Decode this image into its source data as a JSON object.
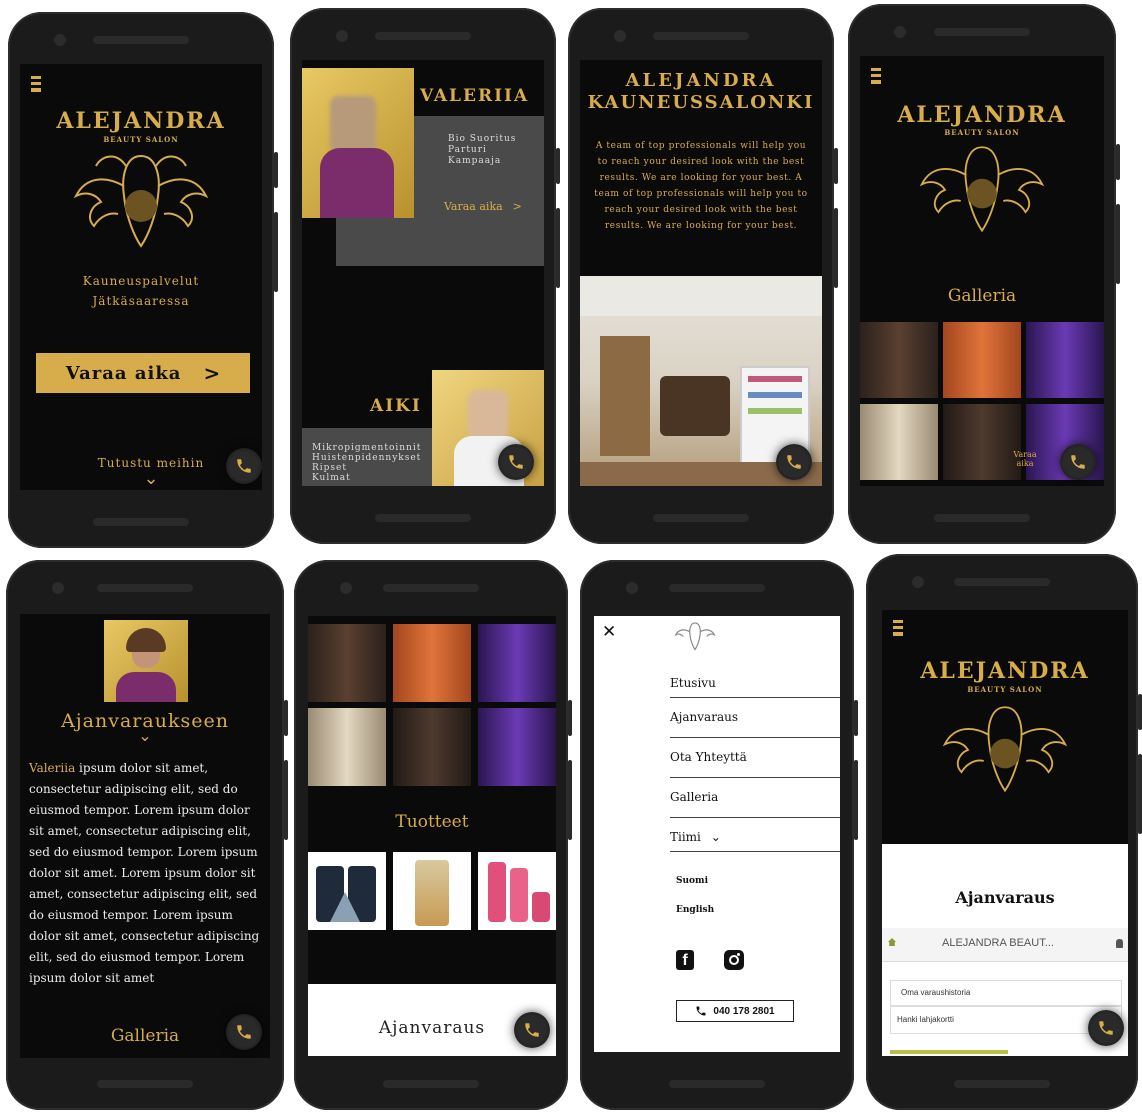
{
  "brand": {
    "name": "ALEJANDRA",
    "subtitle": "BEAUTY SALON"
  },
  "colors": {
    "gold": "#d7ac4a",
    "dark": "#0a0a0a",
    "panel": "#3a3a3a"
  },
  "screen1": {
    "tagline_line1": "Kauneuspalvelut",
    "tagline_line2": "Jätkäsaaressa",
    "book_button": "Varaa aika",
    "book_arrow": ">",
    "intro_link": "Tutustu meihin",
    "chevron": "⌄"
  },
  "screen2": {
    "person1_name": "VALERIIA",
    "person1_services": [
      "Bio Suoritus",
      "Parturi",
      "Kampaaja"
    ],
    "person1_book": "Varaa aika",
    "person1_book_arrow": ">",
    "person2_name": "AIKI",
    "person2_services": [
      "Mikropigmentoinnit",
      "Huistenpidennykset",
      "Ripset",
      "Kulmat"
    ]
  },
  "screen3": {
    "title_line1": "ALEJANDRA",
    "title_line2": "KAUNEUSSALONKI",
    "description": "A team of top professionals will help you to reach your desired look with the best results. We are looking for your best. A team of top professionals will help you to reach your desired look with the best results. We are looking for your best."
  },
  "screen4": {
    "gallery_title": "Galleria",
    "book_mini": "Varaa aika"
  },
  "screen5": {
    "heading": "Ajanvaraukseen",
    "chevron": "⌄",
    "highlight": "Valeriia",
    "body": " ipsum dolor sit amet, consectetur adipiscing elit, sed do eiusmod tempor. Lorem ipsum dolor sit amet, consectetur adipiscing elit, sed do eiusmod tempor. Lorem ipsum dolor sit amet.  Lorem ipsum dolor sit amet, consectetur adipiscing elit, sed do eiusmod tempor. Lorem ipsum dolor sit amet, consectetur adipiscing elit, sed do eiusmod tempor. Lorem ipsum dolor sit amet",
    "gallery_title": "Galleria"
  },
  "screen6": {
    "products_title": "Tuotteet",
    "booking_title": "Ajanvaraus"
  },
  "screen7": {
    "close": "✕",
    "menu": [
      "Etusivu",
      "Ajanvaraus",
      "Ota Yhteyttä",
      "Galleria",
      "Tiimi"
    ],
    "tiimi_chevron": "⌄",
    "lang_fi": "Suomi",
    "lang_en": "English",
    "phone": "040 178 2801"
  },
  "screen8": {
    "booking_title": "Ajanvaraus",
    "widget_title": "ALEJANDRA BEAUT...",
    "history": "Oma varaushistoria",
    "giftcard": "Hanki lahjakortti"
  },
  "icons": {
    "menu": "hamburger-icon",
    "phone": "phone-icon",
    "home": "home-icon",
    "user": "user-icon",
    "facebook": "facebook-icon",
    "instagram": "instagram-icon",
    "close": "close-icon"
  }
}
